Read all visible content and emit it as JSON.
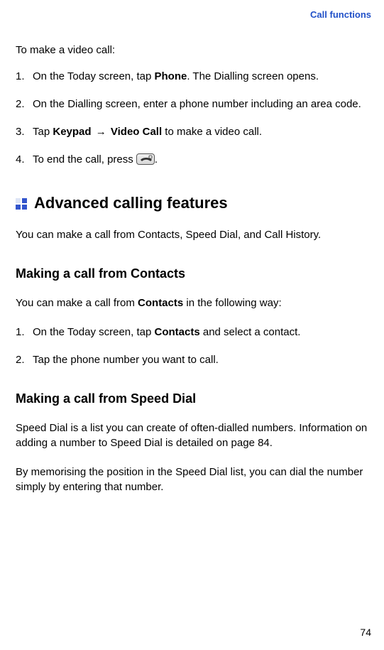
{
  "header": {
    "section_label": "Call functions"
  },
  "video_call": {
    "intro": "To make a video call:",
    "steps": [
      {
        "pre": "On the Today screen, tap ",
        "b1": "Phone",
        "post": ". The Dialling screen opens."
      },
      {
        "text": "On the Dialling screen, enter a phone number including an area code."
      },
      {
        "pre": "Tap ",
        "b1": "Keypad",
        "arrow": " → ",
        "b2": "Video Call",
        "post": " to make a video call."
      },
      {
        "pre": "To end the call, press ",
        "icon": "end-call-icon",
        "post": "."
      }
    ]
  },
  "advanced": {
    "heading": "Advanced calling features",
    "intro": "You can make a call from Contacts, Speed Dial, and Call History."
  },
  "contacts": {
    "heading": "Making a call from Contacts",
    "intro_pre": "You can make a call from ",
    "intro_b": "Contacts",
    "intro_post": " in the following way:",
    "steps": [
      {
        "pre": "On the Today screen, tap ",
        "b1": "Contacts",
        "post": " and select a contact."
      },
      {
        "text": "Tap the phone number you want to call."
      }
    ]
  },
  "speed_dial": {
    "heading": "Making a call from Speed Dial",
    "p1": "Speed Dial is a list you can create of often-dialled numbers. Information on adding a number to Speed Dial is detailed on page 84.",
    "p2": "By memorising the position in the Speed Dial list, you can dial the number simply by entering that number."
  },
  "page_number": "74"
}
